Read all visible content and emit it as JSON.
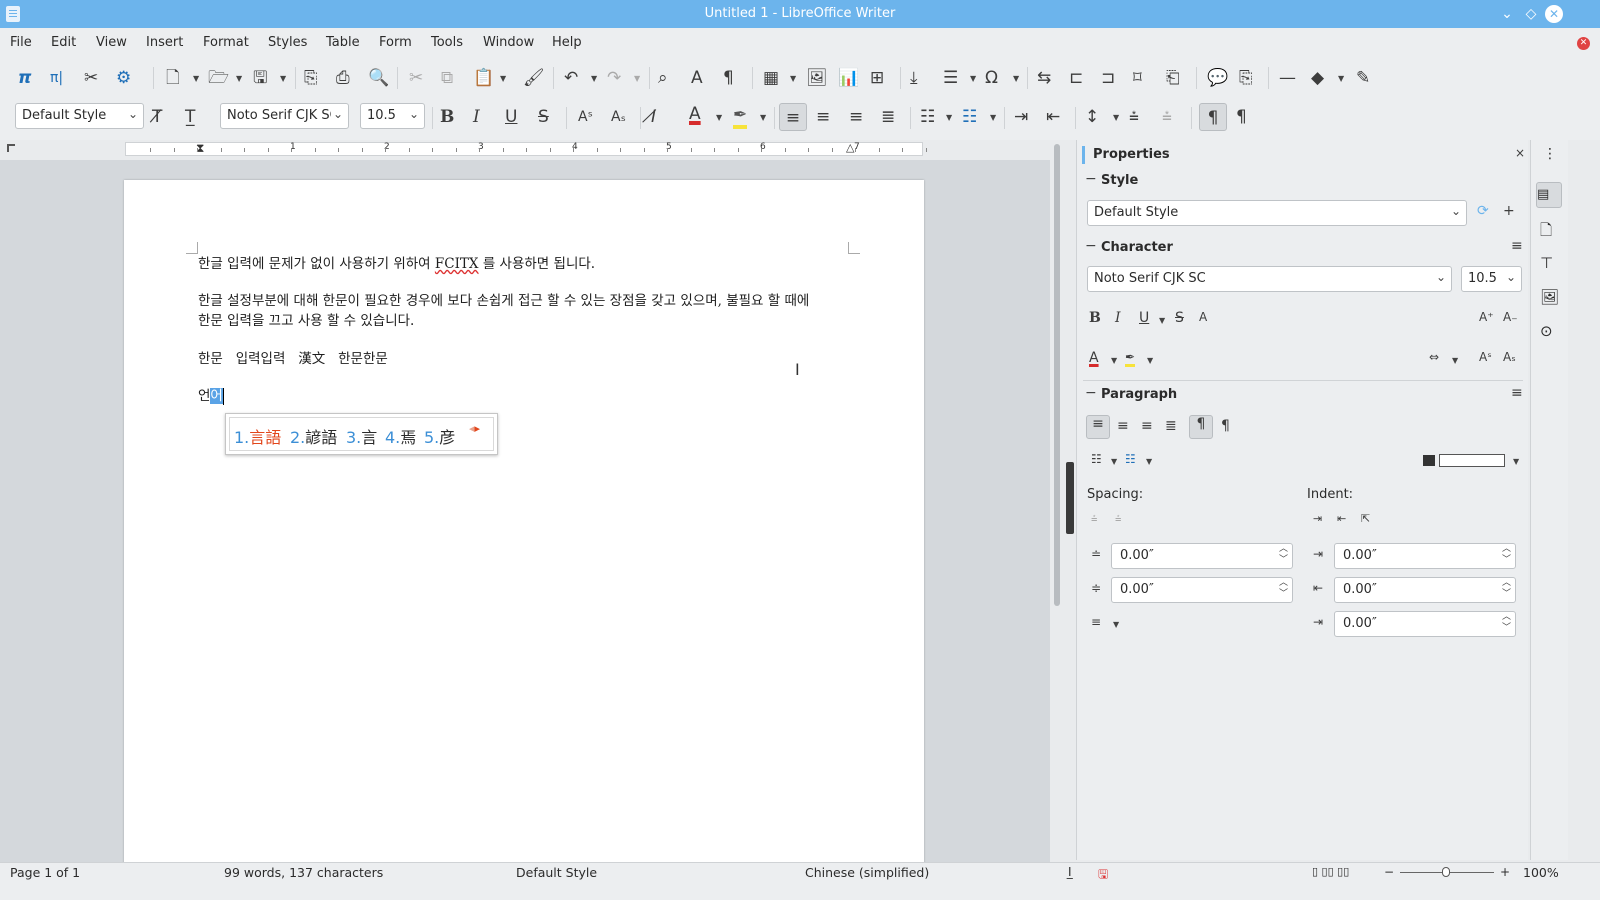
{
  "window": {
    "title": "Untitled 1 - LibreOffice Writer",
    "min_icon": "⌄",
    "max_icon": "◇",
    "close_icon": "✕"
  },
  "menu": [
    "File",
    "Edit",
    "View",
    "Insert",
    "Format",
    "Styles",
    "Table",
    "Form",
    "Tools",
    "Window",
    "Help"
  ],
  "formatting": {
    "paragraph_style": "Default Style",
    "font_name": "Noto Serif CJK SC",
    "font_size": "10.5"
  },
  "ruler": {
    "numbers": [
      "1",
      "2",
      "3",
      "4",
      "5",
      "6",
      "7"
    ]
  },
  "document": {
    "para1_before": "한글 입력에 문제가 없이 사용하기 위하여 ",
    "para1_misspelled": "FCITX",
    "para1_after": " 를 사용하면 됩니다.",
    "para2_line1": "한글 설정부분에 대해 한문이 필요한 경우에 보다 손쉽게 접근 할 수 있는 장점을 갖고 있으며, 불필요 할 때에",
    "para2_line2": "한문 입력을 끄고 사용 할 수 있습니다.",
    "para3": "한문   입력입력   漢文   한문한문",
    "para4_before": "언",
    "para4_selected": "어"
  },
  "ime": {
    "candidates": [
      {
        "num": "1.",
        "word": "言語"
      },
      {
        "num": "2.",
        "word": "諺語"
      },
      {
        "num": "3.",
        "word": "言"
      },
      {
        "num": "4.",
        "word": "焉"
      },
      {
        "num": "5.",
        "word": "彦"
      }
    ],
    "prev": "◂",
    "next": "▸"
  },
  "properties": {
    "title": "Properties",
    "style_section": "Style",
    "style_value": "Default Style",
    "character_section": "Character",
    "font_name": "Noto Serif CJK SC",
    "font_size": "10.5",
    "paragraph_section": "Paragraph",
    "spacing_label": "Spacing:",
    "indent_label": "Indent:",
    "above_spacing": "0.00″",
    "below_spacing": "0.00″",
    "before_indent": "0.00″",
    "after_indent": "0.00″",
    "first_line_indent": "0.00″"
  },
  "status": {
    "page": "Page 1 of 1",
    "words": "99 words, 137 characters",
    "style": "Default Style",
    "language": "Chinese (simplified)",
    "zoom": "100%"
  },
  "colors": {
    "titlebar": "#6cb4ec",
    "selection": "#5aa3e6",
    "font_color_bar": "#d62c2c",
    "highlight_bar": "#f7e33a"
  }
}
